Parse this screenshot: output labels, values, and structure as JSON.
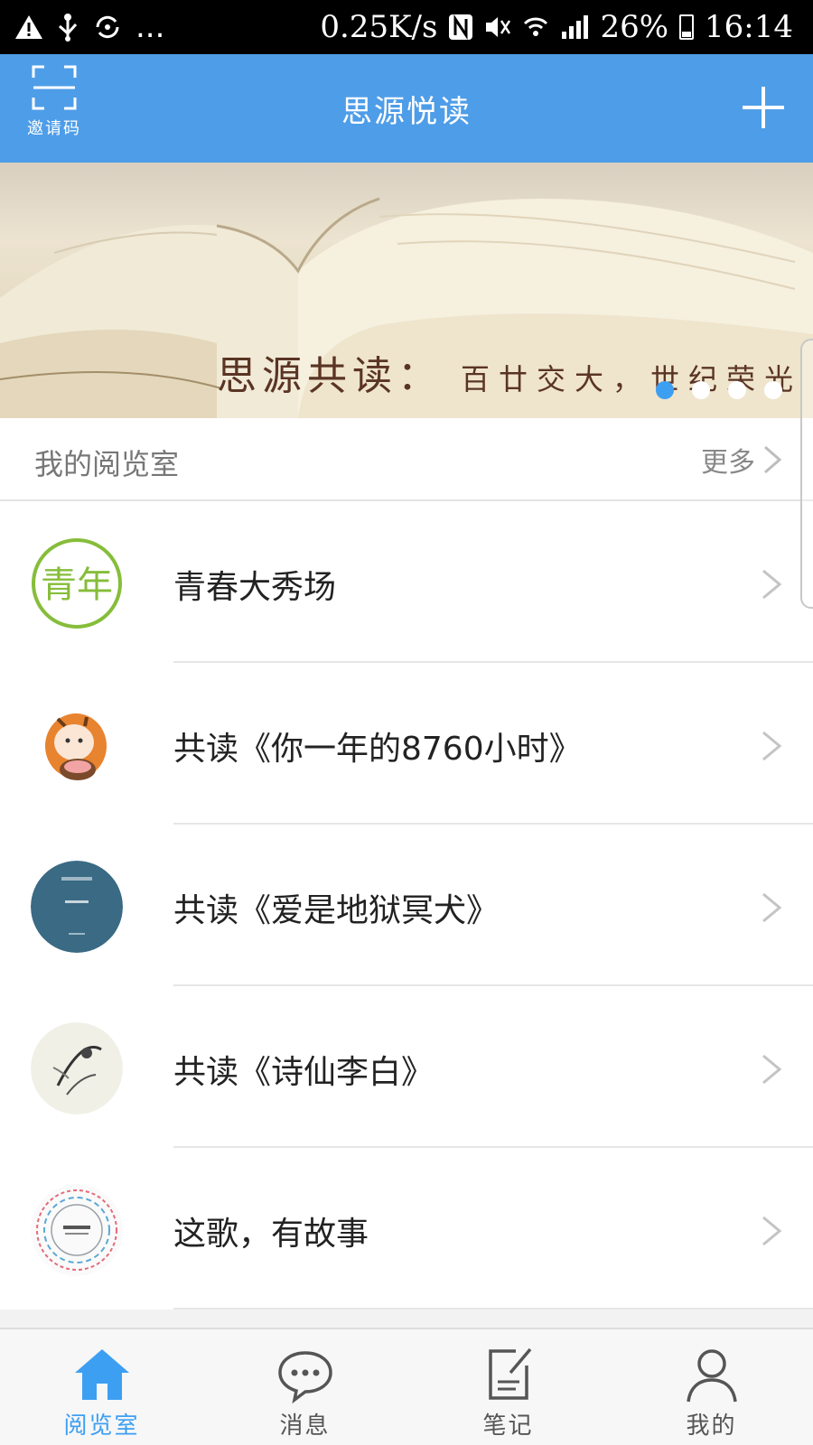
{
  "status_bar": {
    "net_speed": "0.25K/s",
    "battery": "26%",
    "time": "16:14",
    "more": "..."
  },
  "header": {
    "invite_label": "邀请码",
    "title": "思源悦读"
  },
  "banner": {
    "text_main": "思源共读：",
    "text_sub": "百廿交大，世纪荣光",
    "slide_count": 4,
    "active_slide": 1
  },
  "section": {
    "title": "我的阅览室",
    "more_label": "更多"
  },
  "rooms": [
    {
      "label": "青春大秀场",
      "avatar_icon": "qing-logo-icon"
    },
    {
      "label": "共读《你一年的8760小时》",
      "avatar_icon": "tiger-cartoon-icon"
    },
    {
      "label": "共读《爱是地狱冥犬》",
      "avatar_icon": "book-cover-icon"
    },
    {
      "label": "共读《诗仙李白》",
      "avatar_icon": "ink-painting-icon"
    },
    {
      "label": "这歌，有故事",
      "avatar_icon": "music-record-icon"
    }
  ],
  "tabs": [
    {
      "label": "阅览室",
      "icon": "home-icon",
      "active": true
    },
    {
      "label": "消息",
      "icon": "chat-bubble-icon",
      "active": false
    },
    {
      "label": "笔记",
      "icon": "note-edit-icon",
      "active": false
    },
    {
      "label": "我的",
      "icon": "person-icon",
      "active": false
    }
  ],
  "colors": {
    "header_bg": "#4e9de8",
    "accent": "#3d9ff2",
    "text": "#222222"
  }
}
